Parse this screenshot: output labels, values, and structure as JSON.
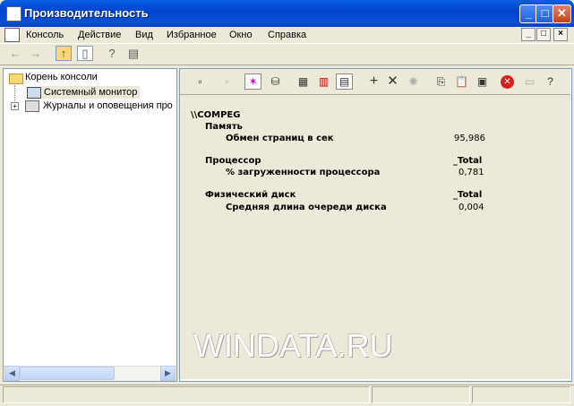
{
  "window": {
    "title": "Производительность",
    "controls": [
      "_",
      "□",
      "✕"
    ]
  },
  "menu": [
    "Консоль",
    "Действие",
    "Вид",
    "Избранное",
    "Окно",
    "Справка"
  ],
  "mdi_controls": [
    "_",
    "□",
    "×"
  ],
  "tree": {
    "root": "Корень консоли",
    "items": [
      {
        "label": "Системный монитор",
        "selected": true
      },
      {
        "label": "Журналы и оповещения про",
        "expander": "+"
      }
    ]
  },
  "report": {
    "computer": "\\\\COMPEG",
    "objects": [
      {
        "name": "Память",
        "instance": "",
        "counters": [
          {
            "name": "Обмен страниц в сек",
            "value": "95,986"
          }
        ]
      },
      {
        "name": "Процессор",
        "instance": "_Total",
        "counters": [
          {
            "name": "% загруженности процессора",
            "value": "0,781"
          }
        ]
      },
      {
        "name": "Физический диск",
        "instance": "_Total",
        "counters": [
          {
            "name": "Средняя длина очереди диска",
            "value": "0,004"
          }
        ]
      }
    ]
  },
  "watermark": "WINDATA.RU",
  "colors": {
    "title_bar": "#0A4FD8",
    "face": "#ECE9D8",
    "close": "#C8411A"
  }
}
